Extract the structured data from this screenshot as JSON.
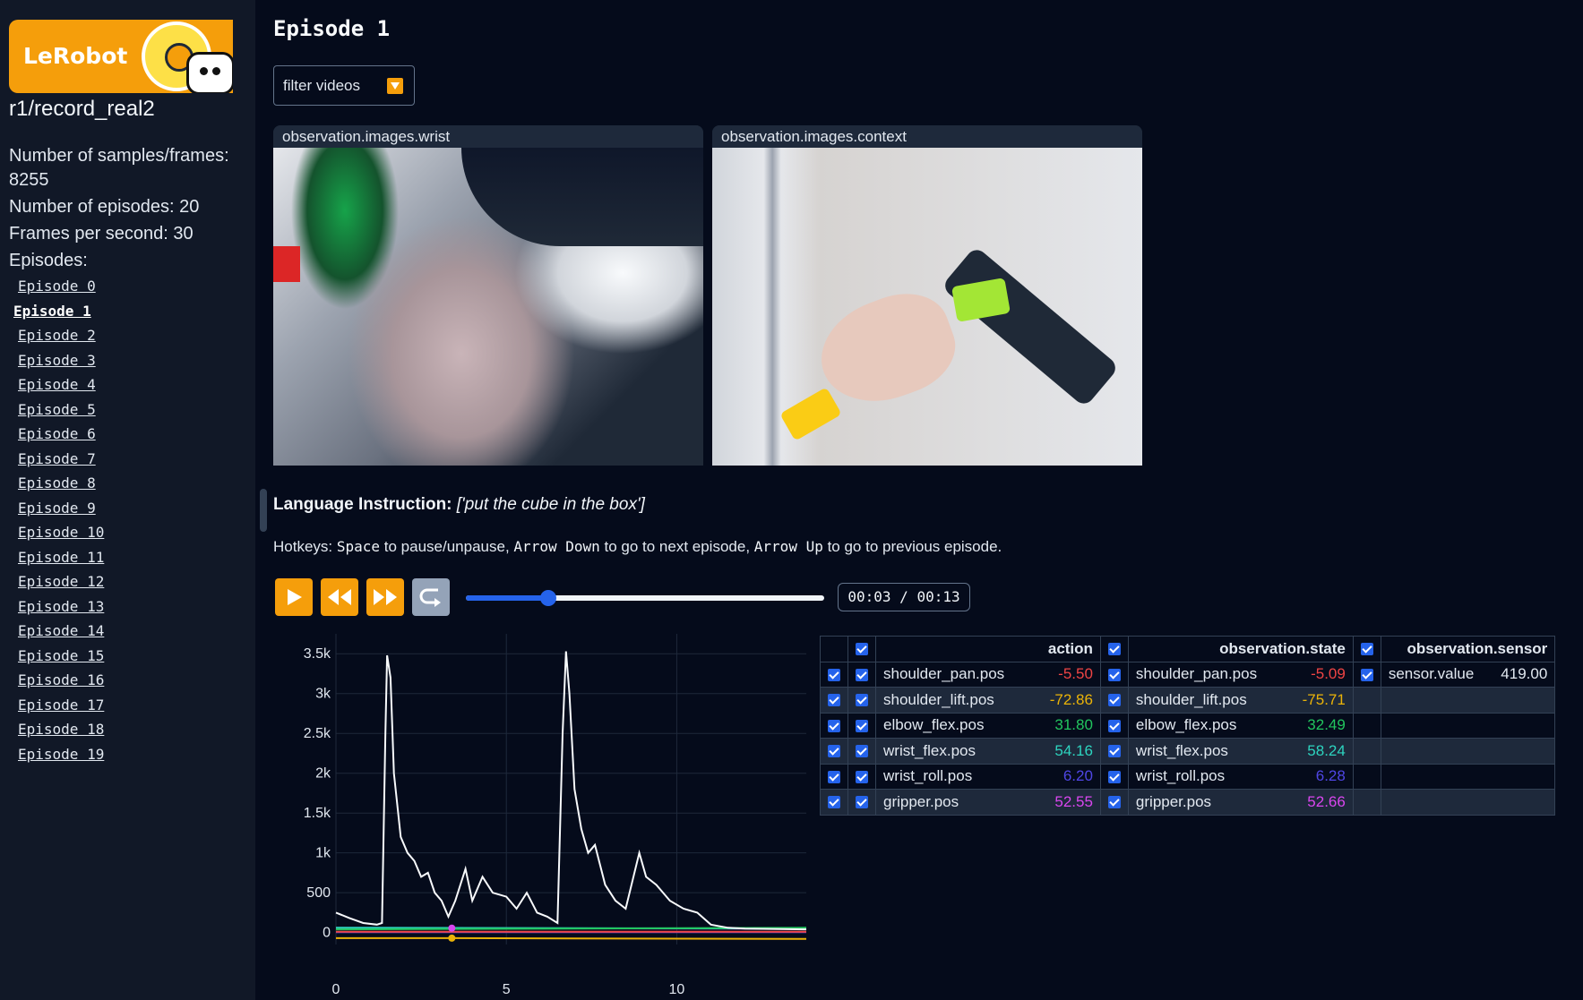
{
  "sidebar": {
    "logo_text": "LeRobot",
    "repo": "r1/record_real2",
    "stats": {
      "samples_label": "Number of samples/frames:",
      "samples_value": "8255",
      "episodes": "Number of episodes: 20",
      "fps": "Frames per second: 30",
      "episodes_heading": "Episodes:"
    },
    "episodes": [
      "Episode 0",
      "Episode 1",
      "Episode 2",
      "Episode 3",
      "Episode 4",
      "Episode 5",
      "Episode 6",
      "Episode 7",
      "Episode 8",
      "Episode 9",
      "Episode 10",
      "Episode 11",
      "Episode 12",
      "Episode 13",
      "Episode 14",
      "Episode 15",
      "Episode 16",
      "Episode 17",
      "Episode 18",
      "Episode 19"
    ],
    "active_episode": 1
  },
  "main": {
    "title": "Episode 1",
    "filter_label": "filter videos",
    "videos": [
      {
        "label": "observation.images.wrist"
      },
      {
        "label": "observation.images.context"
      }
    ],
    "language": {
      "label": "Language Instruction:",
      "value": "['put the cube in the box']"
    },
    "hotkeys": {
      "prefix": "Hotkeys:",
      "space": "Space",
      "t1": "to pause/unpause,",
      "down": "Arrow Down",
      "t2": "to go to next episode,",
      "up": "Arrow Up",
      "t3": "to go to previous episode."
    },
    "player": {
      "time": "00:03 / 00:13",
      "progress": 0.23
    }
  },
  "table": {
    "headers": {
      "action": "action",
      "state": "observation.state",
      "sensor": "observation.sensor"
    },
    "rows": [
      {
        "a_name": "shoulder_pan.pos",
        "a_val": "-5.50",
        "s_name": "shoulder_pan.pos",
        "s_val": "-5.09",
        "color": "#ef4444",
        "sensor_name": "sensor.value",
        "sensor_val": "419.00"
      },
      {
        "a_name": "shoulder_lift.pos",
        "a_val": "-72.86",
        "s_name": "shoulder_lift.pos",
        "s_val": "-75.71",
        "color": "#eab308"
      },
      {
        "a_name": "elbow_flex.pos",
        "a_val": "31.80",
        "s_name": "elbow_flex.pos",
        "s_val": "32.49",
        "color": "#22c55e"
      },
      {
        "a_name": "wrist_flex.pos",
        "a_val": "54.16",
        "s_name": "wrist_flex.pos",
        "s_val": "58.24",
        "color": "#2dd4bf"
      },
      {
        "a_name": "wrist_roll.pos",
        "a_val": "6.20",
        "s_name": "wrist_roll.pos",
        "s_val": "6.28",
        "color": "#4f46e5"
      },
      {
        "a_name": "gripper.pos",
        "a_val": "52.55",
        "s_name": "gripper.pos",
        "s_val": "52.66",
        "color": "#d946ef"
      }
    ]
  },
  "chart_data": {
    "type": "line",
    "x_ticks": [
      "0",
      "5",
      "10"
    ],
    "y_ticks": [
      "0",
      "500",
      "1k",
      "1.5k",
      "2k",
      "2.5k",
      "3k",
      "3.5k"
    ],
    "xlim": [
      0,
      13.8
    ],
    "ylim": [
      -150,
      3750
    ],
    "cursor_x": 3.4,
    "series": [
      {
        "color": "#f8fafc",
        "points": [
          [
            0,
            250
          ],
          [
            0.4,
            180
          ],
          [
            0.8,
            120
          ],
          [
            1.2,
            100
          ],
          [
            1.35,
            120
          ],
          [
            1.45,
            2500
          ],
          [
            1.5,
            3480
          ],
          [
            1.6,
            3200
          ],
          [
            1.7,
            2000
          ],
          [
            1.9,
            1200
          ],
          [
            2.1,
            1000
          ],
          [
            2.3,
            900
          ],
          [
            2.5,
            700
          ],
          [
            2.7,
            750
          ],
          [
            2.9,
            500
          ],
          [
            3.1,
            400
          ],
          [
            3.3,
            200
          ],
          [
            3.5,
            400
          ],
          [
            3.8,
            800
          ],
          [
            4.0,
            400
          ],
          [
            4.3,
            700
          ],
          [
            4.6,
            500
          ],
          [
            5.0,
            450
          ],
          [
            5.3,
            300
          ],
          [
            5.6,
            500
          ],
          [
            5.9,
            250
          ],
          [
            6.2,
            200
          ],
          [
            6.5,
            120
          ],
          [
            6.65,
            2500
          ],
          [
            6.75,
            3530
          ],
          [
            6.85,
            3000
          ],
          [
            7.0,
            1800
          ],
          [
            7.2,
            1300
          ],
          [
            7.4,
            1000
          ],
          [
            7.6,
            1100
          ],
          [
            7.9,
            600
          ],
          [
            8.2,
            400
          ],
          [
            8.5,
            300
          ],
          [
            8.9,
            1000
          ],
          [
            9.1,
            700
          ],
          [
            9.4,
            600
          ],
          [
            9.8,
            400
          ],
          [
            10.2,
            300
          ],
          [
            10.6,
            250
          ],
          [
            11.0,
            100
          ],
          [
            11.5,
            60
          ],
          [
            12.0,
            50
          ],
          [
            13.8,
            40
          ]
        ]
      },
      {
        "color": "#ef4444",
        "points": [
          [
            0,
            10
          ],
          [
            13.8,
            10
          ]
        ]
      },
      {
        "color": "#eab308",
        "points": [
          [
            0,
            -70
          ],
          [
            3.4,
            -70
          ],
          [
            13.8,
            -80
          ]
        ]
      },
      {
        "color": "#22c55e",
        "points": [
          [
            0,
            40
          ],
          [
            13.8,
            60
          ]
        ]
      },
      {
        "color": "#2dd4bf",
        "points": [
          [
            0,
            60
          ],
          [
            13.8,
            50
          ]
        ]
      },
      {
        "color": "#4f46e5",
        "points": [
          [
            0,
            5
          ],
          [
            13.8,
            5
          ]
        ]
      },
      {
        "color": "#d946ef",
        "points": [
          [
            0,
            55
          ],
          [
            13.8,
            50
          ]
        ]
      }
    ]
  }
}
